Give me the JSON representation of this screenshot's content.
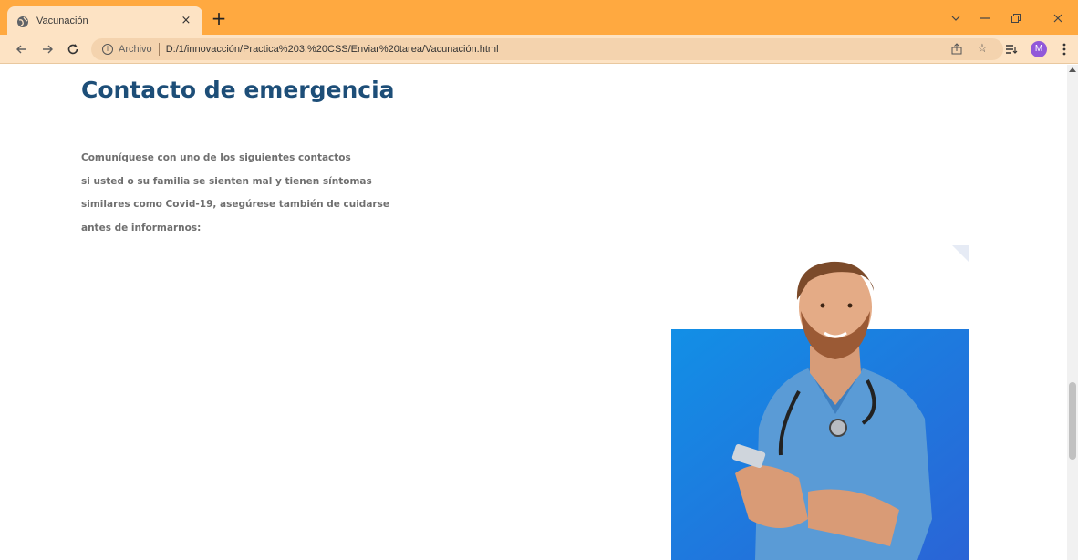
{
  "browser": {
    "tab_title": "Vacunación",
    "tab_close": "×",
    "new_tab": "+",
    "url_scheme": "Archivo",
    "url": "D:/1/innovacción/Practica%203.%20CSS/Enviar%20tarea/Vacunación.html",
    "profile_initial": "M",
    "icons": [
      "globe-icon",
      "close-icon",
      "plus-icon",
      "chevron-down-icon",
      "minimize-icon",
      "restore-icon",
      "close-window-icon",
      "back-icon",
      "forward-icon",
      "reload-icon",
      "info-icon",
      "share-icon",
      "star-icon",
      "reading-list-icon",
      "more-icon"
    ],
    "accent_color": "#ffa940",
    "toolbar_color": "#fde3c4"
  },
  "content": {
    "heading": "Contacto de emergencia",
    "heading_color": "#1d4e78",
    "paragraph_lines": [
      "Comuníquese con uno de los siguientes contactos",
      "si usted o su familia se sienten mal y tienen síntomas",
      "similares como Covid-19, asegúrese también de cuidarse",
      "antes de informarnos:"
    ],
    "image": {
      "subject": "smiling doctor in blue scrubs with stethoscope holding phone",
      "background_color": "#1f86e0"
    }
  }
}
